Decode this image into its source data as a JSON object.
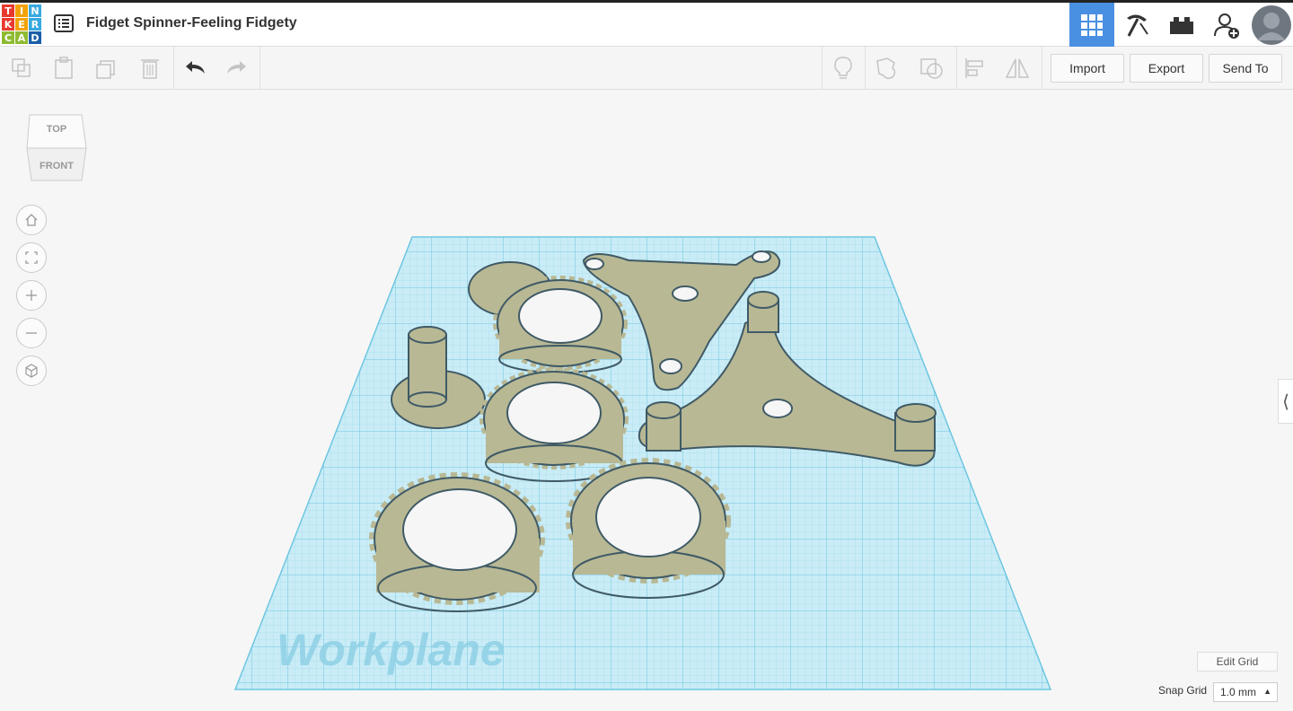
{
  "app": {
    "logo_letters": [
      "T",
      "I",
      "N",
      "K",
      "E",
      "R",
      "C",
      "A",
      "D"
    ],
    "logo_colors": [
      "#e8392e",
      "#f2a20a",
      "#37a9e0",
      "#e8392e",
      "#f2a20a",
      "#37a9e0",
      "#8fbb32",
      "#8fbb32",
      "#1a5ea8"
    ],
    "title": "Fidget Spinner-Feeling Fidgety"
  },
  "top_icons": [
    {
      "name": "grid-view-icon",
      "active": true
    },
    {
      "name": "pickaxe-icon",
      "active": false
    },
    {
      "name": "bricks-icon",
      "active": false
    },
    {
      "name": "add-user-icon",
      "active": false
    },
    {
      "name": "avatar",
      "active": false
    }
  ],
  "toolbar": {
    "import_label": "Import",
    "export_label": "Export",
    "send_to_label": "Send To"
  },
  "viewcube": {
    "top_label": "TOP",
    "front_label": "FRONT"
  },
  "workplane": {
    "label": "Workplane",
    "grid_color": "#7fd0e8",
    "shape_color": "#b8b894"
  },
  "grid_controls": {
    "edit_grid_label": "Edit Grid",
    "snap_grid_label": "Snap Grid",
    "snap_grid_value": "1.0 mm"
  },
  "accent_color": "#4a90e2"
}
